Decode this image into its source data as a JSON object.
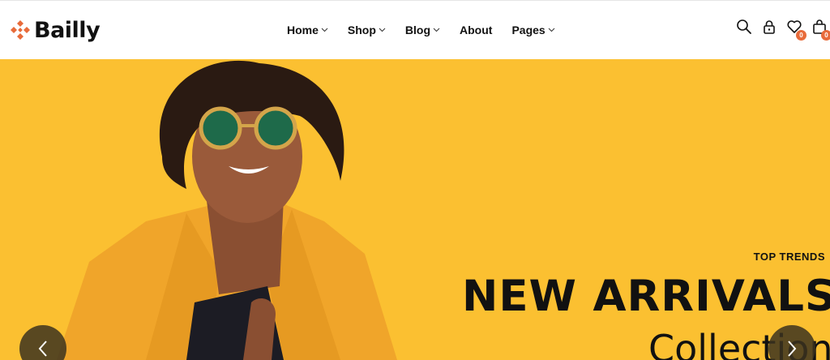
{
  "brand": {
    "name": "Bailly",
    "accent": "#e86b3a"
  },
  "nav": [
    {
      "label": "Home",
      "dropdown": true
    },
    {
      "label": "Shop",
      "dropdown": true
    },
    {
      "label": "Blog",
      "dropdown": true
    },
    {
      "label": "About",
      "dropdown": false
    },
    {
      "label": "Pages",
      "dropdown": true
    }
  ],
  "header_icons": {
    "search": "search-icon",
    "account": "lock-icon",
    "wishlist": "heart-icon",
    "cart": "bag-icon",
    "wishlist_count": "0",
    "cart_count": "0"
  },
  "hero": {
    "subtitle": "TOP TRENDS",
    "title": "NEW ARRIVALS",
    "title_line2": "Collection",
    "background": "#fbc031"
  },
  "slider": {
    "prev": "chevron-left-icon",
    "next": "chevron-right-icon"
  }
}
